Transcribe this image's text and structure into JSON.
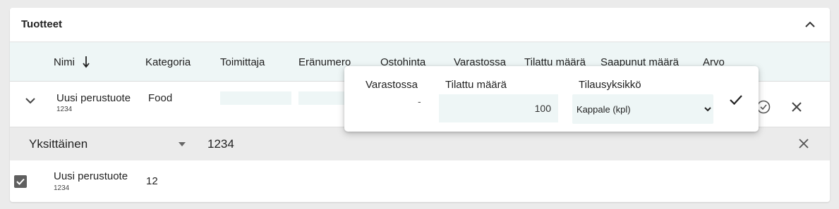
{
  "panel": {
    "title": "Tuotteet"
  },
  "table": {
    "columns": [
      "Nimi",
      "Kategoria",
      "Toimittaja",
      "Eränumero",
      "Ostohinta",
      "Varastossa",
      "Tilattu määrä",
      "Saapunut määrä",
      "Arvo"
    ],
    "row": {
      "name": "Uusi perustuote",
      "code": "1234",
      "category": "Food"
    }
  },
  "group": {
    "type": "Yksittäinen",
    "value": "1234"
  },
  "item": {
    "name": "Uusi perustuote",
    "code": "1234",
    "qty": "12",
    "checked": true
  },
  "popover": {
    "stock_label": "Varastossa",
    "stock_value": "-",
    "ordered_label": "Tilattu määrä",
    "ordered_value": "100",
    "unit_label": "Tilausyksikkö",
    "unit_value": "Kappale (kpl)"
  },
  "colors": {
    "header_bg": "#eef6f6",
    "group_bg": "#ebebeb",
    "checkbox": "#5f5f5f"
  },
  "icons": [
    "chevron-up-icon",
    "arrow-down-icon",
    "chevron-down-icon",
    "check-circle-icon",
    "close-icon",
    "caret-down-icon",
    "checkbox-checked-icon",
    "check-icon"
  ]
}
